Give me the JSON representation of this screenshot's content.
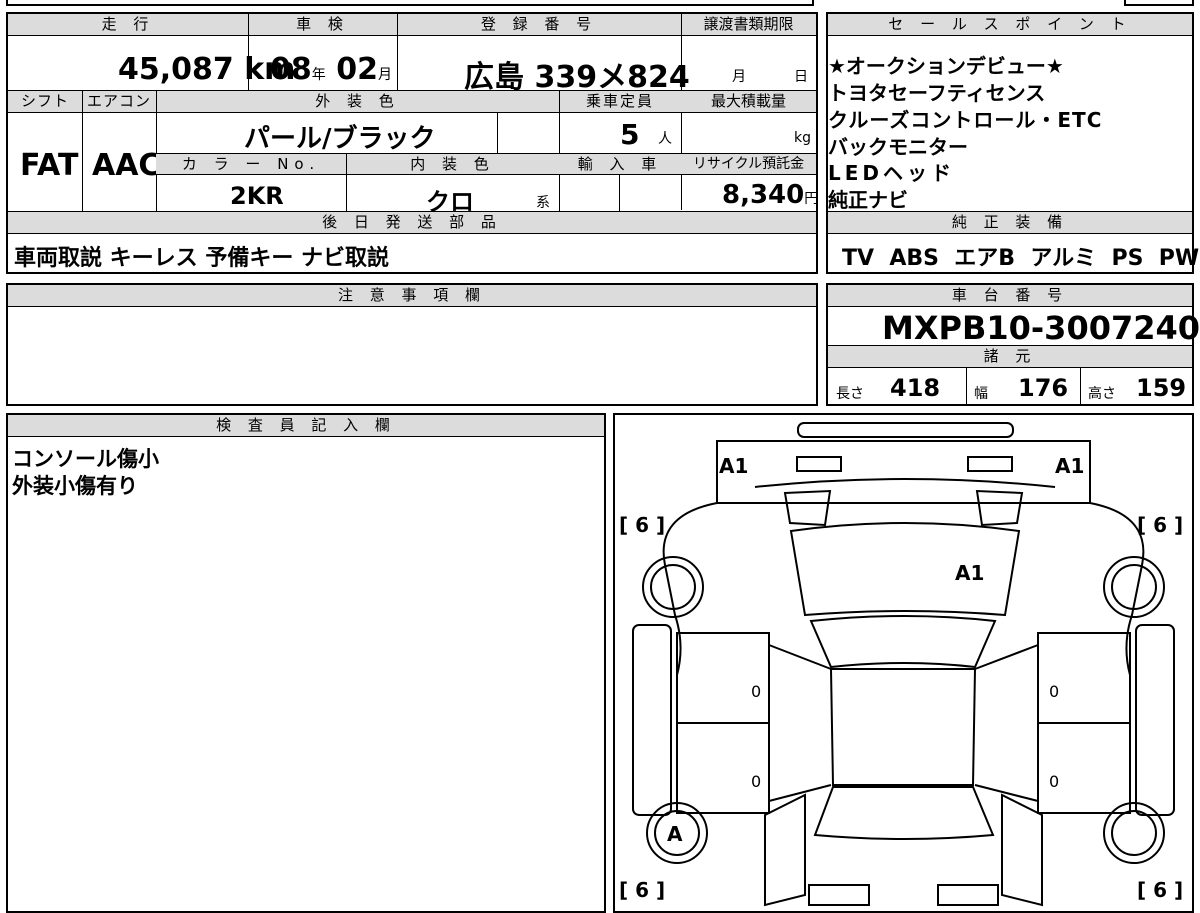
{
  "mileage": {
    "header": "走 行",
    "value": "45,087",
    "unit": "km"
  },
  "inspection": {
    "header": "車 検",
    "year": "08",
    "year_unit": "年",
    "month": "02",
    "month_unit": "月"
  },
  "registration": {
    "header": "登 録 番 号",
    "value": "広島 339メ824"
  },
  "transfer_deadline": {
    "header": "譲渡書類期限",
    "month_unit": "月",
    "day_unit": "日"
  },
  "shift": {
    "header": "シフト",
    "value": "FAT"
  },
  "aircon": {
    "header": "エアコン",
    "value": "AAC"
  },
  "exterior_color": {
    "header": "外 装 色",
    "value": "パール/ブラック"
  },
  "capacity": {
    "header": "乗車定員",
    "value": "5",
    "unit": "人"
  },
  "max_load": {
    "header": "最大積載量",
    "unit": "kg"
  },
  "color_no": {
    "header": "カ ラ ー No.",
    "value": "2KR"
  },
  "interior_color": {
    "header": "内 装 色",
    "value": "クロ",
    "unit": "系"
  },
  "import": {
    "header": "輸 入 車"
  },
  "recycle": {
    "header": "リサイクル預託金",
    "value": "8,340",
    "unit": "円"
  },
  "later_parts": {
    "header": "後 日 発 送 部 品",
    "value": "車両取説 キーレス 予備キー ナビ取説"
  },
  "sales_points": {
    "header": "セ ー ル ス ポ イ ン ト",
    "lines": [
      "★オークションデビュー★",
      "トヨタセーフティセンス",
      "クルーズコントロール・ETC",
      "バックモニター",
      "LEDヘッド",
      "純正ナビ"
    ]
  },
  "genuine_equipment": {
    "header": "純 正 装 備",
    "value": "TV  ABS  エアB  アルミ  PS  PW"
  },
  "notes": {
    "header": "注 意 事 項 欄"
  },
  "chassis": {
    "header": "車 台 番 号",
    "value": "MXPB10-3007240"
  },
  "specs": {
    "header": "諸 元",
    "length_label": "長さ",
    "length": "418",
    "width_label": "幅",
    "width": "176",
    "height_label": "高さ",
    "height": "159"
  },
  "inspector": {
    "header": "検 査 員 記 入 欄",
    "lines": [
      "コンソール傷小",
      "外装小傷有り"
    ]
  },
  "diagram": {
    "mark_a1_left": "A1",
    "mark_a1_right": "A1",
    "mark_a1_hood": "A1",
    "mark_a_wheel": "A",
    "tire_fl": "[ 6 ]",
    "tire_fr": "[ 6 ]",
    "tire_rl": "[ 6 ]",
    "tire_rr": "[ 6 ]",
    "door_fl": "0",
    "door_fr": "0",
    "door_rl": "0",
    "door_rr": "0"
  }
}
